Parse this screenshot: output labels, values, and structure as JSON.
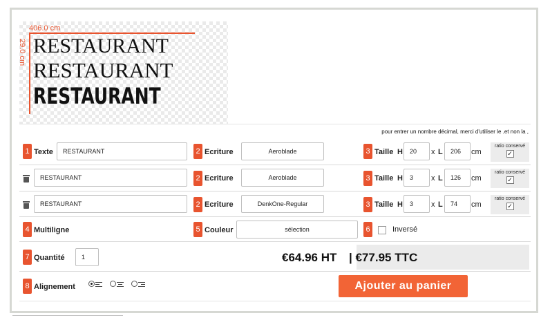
{
  "preview": {
    "width_label": "406.0 cm",
    "height_label": "29.0 cm",
    "lines": [
      "RESTAURANT",
      "RESTAURANT",
      "RESTAURANT"
    ]
  },
  "note": "pour entrer un nombre décimal, merci d'utiliser le .et non la ,",
  "rows": [
    {
      "num": "1",
      "label": "Texte",
      "text": "RESTAURANT",
      "font_num": "2",
      "font_label": "Ecriture",
      "font": "Aeroblade",
      "size_num": "3",
      "size_label": "Taille",
      "h_label": "H",
      "h": "20",
      "l_label": "L",
      "l": "206",
      "unit": "cm",
      "ratio_label": "ratio conservé",
      "ratio_checked": "✓"
    },
    {
      "num": "",
      "label": "",
      "text": "RESTAURANT",
      "font_num": "2",
      "font_label": "Ecriture",
      "font": "Aeroblade",
      "size_num": "3",
      "size_label": "Taille",
      "h_label": "H",
      "h": "3",
      "l_label": "L",
      "l": "126",
      "unit": "cm",
      "ratio_label": "ratio conservé",
      "ratio_checked": "✓"
    },
    {
      "num": "",
      "label": "",
      "text": "RESTAURANT",
      "font_num": "2",
      "font_label": "Ecriture",
      "font": "DenkOne-Regular",
      "size_num": "3",
      "size_label": "Taille",
      "h_label": "H",
      "h": "3",
      "l_label": "L",
      "l": "74",
      "unit": "cm",
      "ratio_label": "ratio conservé",
      "ratio_checked": "✓"
    }
  ],
  "multiline": {
    "num": "4",
    "label": "Multiligne"
  },
  "color": {
    "num": "5",
    "label": "Couleur",
    "value": "sélection"
  },
  "inverse": {
    "num": "6",
    "label": "Inversé"
  },
  "quantity": {
    "num": "7",
    "label": "Quantité",
    "value": "1"
  },
  "price": {
    "ht": "€64.96 HT",
    "ttc": "| €77.95 TTC"
  },
  "alignment": {
    "num": "8",
    "label": "Alignement",
    "selected": "left"
  },
  "cart_button": "Ajouter au panier",
  "colors": {
    "accent": "#e8542f",
    "button": "#f26436"
  }
}
